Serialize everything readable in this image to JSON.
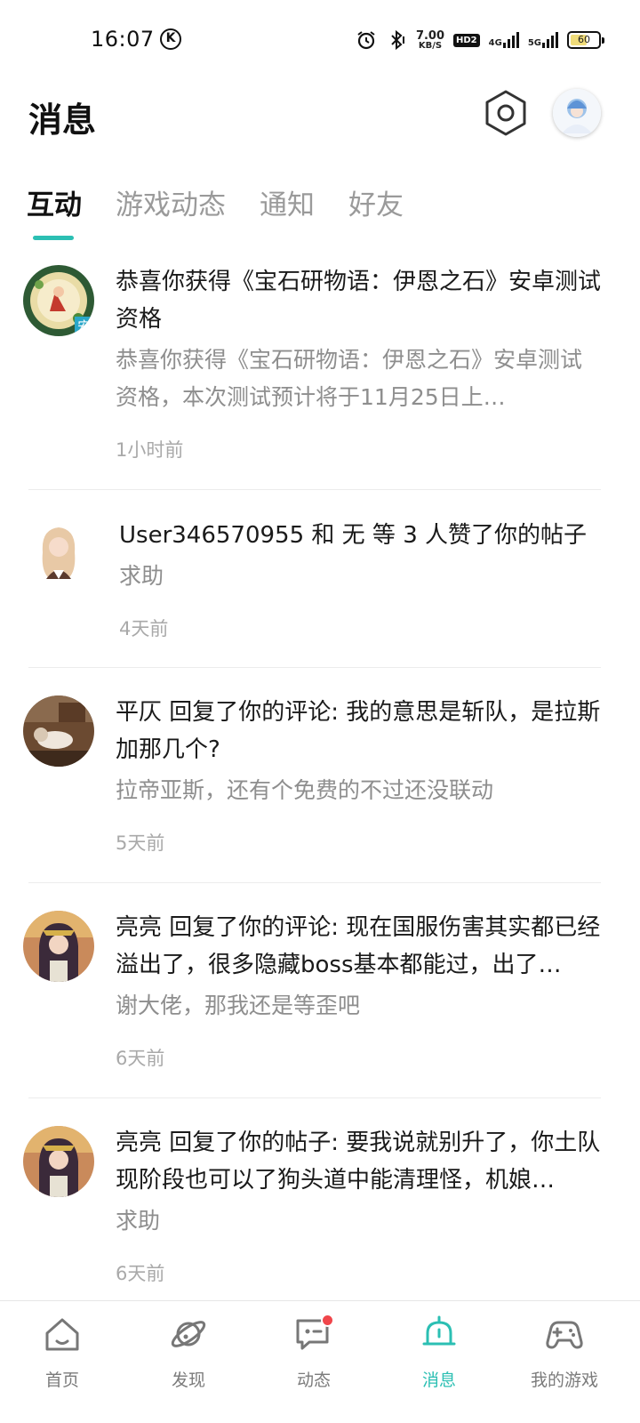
{
  "status_bar": {
    "time": "16:07",
    "k_badge": "K",
    "speed_value": "7.00",
    "speed_unit": "KB/S",
    "hd_label": "HD2",
    "net_4g": "4G",
    "net_5g": "5G",
    "battery": "60"
  },
  "header": {
    "title": "消息"
  },
  "tabs": [
    {
      "label": "互动",
      "active": true
    },
    {
      "label": "游戏动态",
      "active": false
    },
    {
      "label": "通知",
      "active": false
    },
    {
      "label": "好友",
      "active": false
    }
  ],
  "messages": [
    {
      "title": "恭喜你获得《宝石研物语：伊恩之石》安卓测试资格",
      "subtitle": "恭喜你获得《宝石研物语：伊恩之石》安卓测试资格，本次测试预计将于11月25日上…",
      "time": "1小时前"
    },
    {
      "title": "User346570955 和 无 等 3 人赞了你的帖子",
      "subtitle": "求助",
      "time": "4天前"
    },
    {
      "title": "平仄 回复了你的评论: 我的意思是斩队，是拉斯加那几个?",
      "subtitle": "拉帝亚斯，还有个免费的不过还没联动",
      "time": "5天前"
    },
    {
      "title": "亮亮 回复了你的评论: 现在国服伤害其实都已经溢出了，很多隐藏boss基本都能过，出了…",
      "subtitle": "谢大佬，那我还是等歪吧",
      "time": "6天前"
    },
    {
      "title": "亮亮 回复了你的帖子: 要我说就别升了，你土队现阶段也可以了狗头道中能清理怪，机娘…",
      "subtitle": "求助",
      "time": "6天前"
    }
  ],
  "bottom_nav": [
    {
      "label": "首页",
      "icon": "home-icon"
    },
    {
      "label": "发现",
      "icon": "planet-icon"
    },
    {
      "label": "动态",
      "icon": "chat-icon"
    },
    {
      "label": "消息",
      "icon": "bell-icon"
    },
    {
      "label": "我的游戏",
      "icon": "gamepad-icon"
    }
  ],
  "colors": {
    "accent": "#2bbfb3",
    "notification_dot": "#f0464b"
  }
}
